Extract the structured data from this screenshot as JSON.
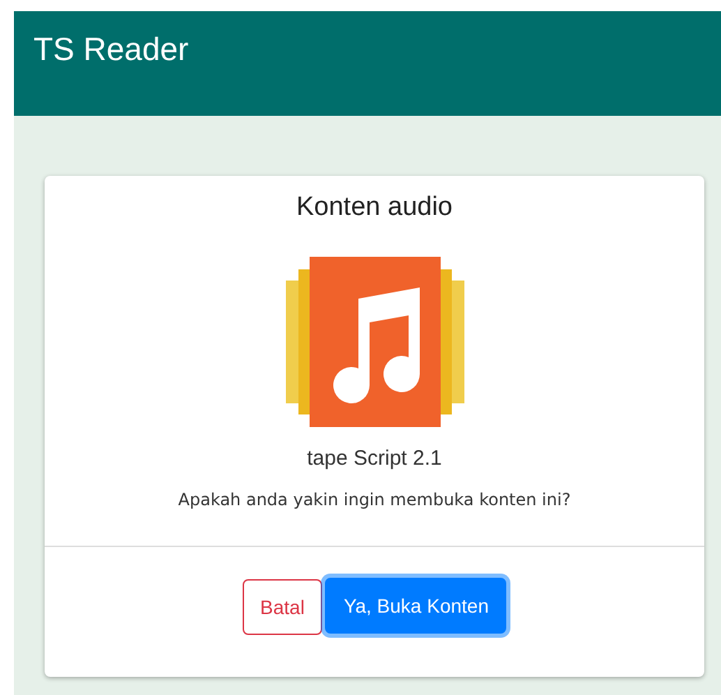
{
  "app_bar": {
    "title": "TS Reader"
  },
  "dialog": {
    "title": "Konten audio",
    "content_name": "tape Script 2.1",
    "question": "Apakah anda yakin ingin membuka konten ini?",
    "buttons": [
      {
        "label": "Batal",
        "kind": "cancel",
        "focused": false
      },
      {
        "label": "Ya, Buka Konten",
        "kind": "confirm",
        "focused": true
      }
    ]
  }
}
